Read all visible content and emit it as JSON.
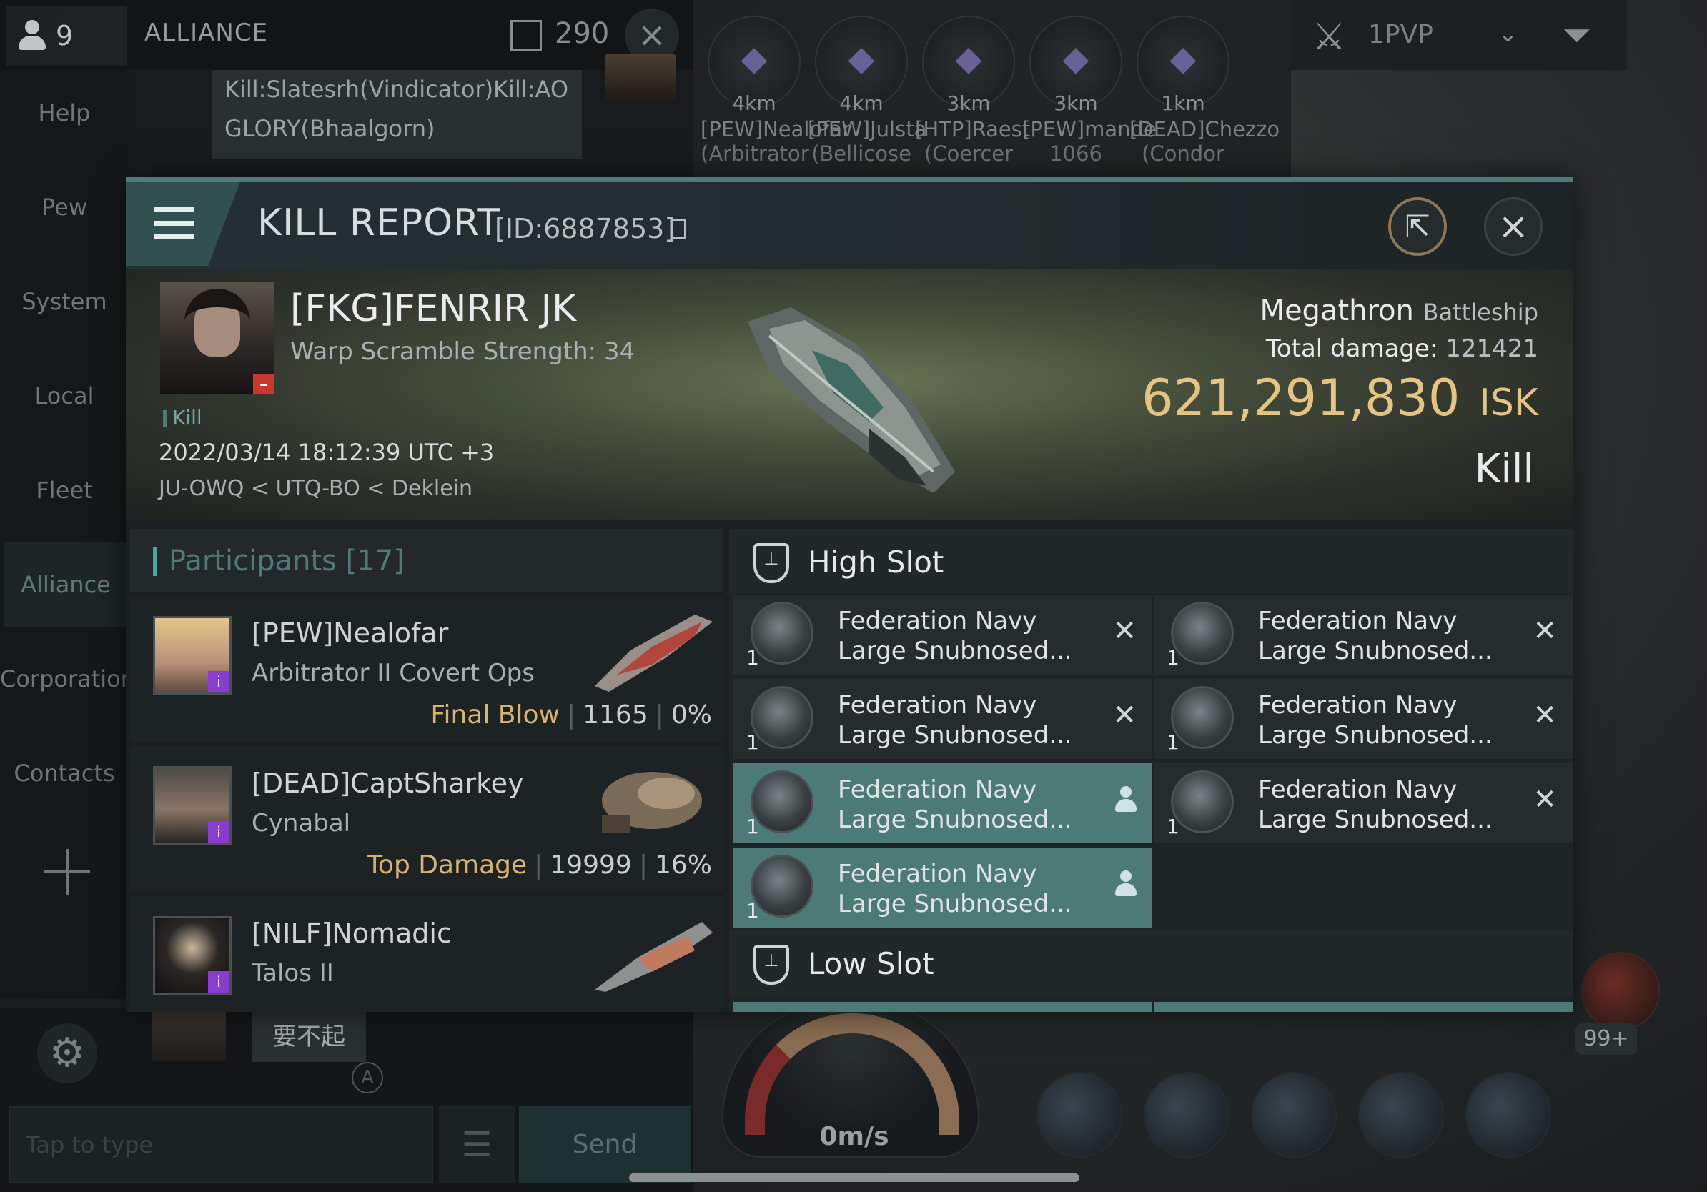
{
  "chat": {
    "member_count": "9",
    "channel_title": "ALLIANCE",
    "channel_count": "290",
    "close_icon": "close-icon",
    "top_message": "Kill:Slatesrh(Vindicator)Kill:AO GLORY(Bhaalgorn)",
    "bottom_message": "要不起",
    "bottom_marker": "A",
    "input_placeholder": "Tap to type",
    "send_label": "Send"
  },
  "nav": {
    "items": [
      "Help",
      "Pew",
      "System",
      "Local",
      "Fleet",
      "Alliance",
      "Corporation",
      "Contacts"
    ],
    "active": "Alliance"
  },
  "overview": {
    "targets": [
      {
        "distance": "4km",
        "name": "[PEW]Nealofar",
        "ship": "(Arbitrator"
      },
      {
        "distance": "4km",
        "name": "[PEW]Julsta",
        "ship": "(Bellicose"
      },
      {
        "distance": "3km",
        "name": "[HTP]Raest",
        "ship": "(Coercer"
      },
      {
        "distance": "3km",
        "name": "[PEW]mande",
        "ship": "1066"
      },
      {
        "distance": "1km",
        "name": "[DEAD]Chezzo",
        "ship": "(Condor"
      }
    ],
    "filter_label": "1PVP"
  },
  "hud": {
    "speed": "0m/s",
    "badge": "99+"
  },
  "kill_report": {
    "title": "KILL REPORT",
    "id": "[ID:6887853]",
    "victim": {
      "name": "[FKG]FENRIR JK",
      "subtitle": "Warp Scramble Strength: 34",
      "tag": "Kill",
      "time": "2022/03/14 18:12:39 UTC +3",
      "location": "JU-OWQ < UTQ-BO < Deklein"
    },
    "ship": {
      "name": "Megathron",
      "class": "Battleship",
      "damage_label": "Total damage:",
      "damage_value": "121421",
      "isk_value": "621,291,830",
      "isk_unit": "ISK",
      "result": "Kill"
    },
    "participants": {
      "header": "Participants [17]",
      "rows": [
        {
          "name": "[PEW]Nealofar",
          "ship": "Arbitrator II Covert Ops",
          "label": "Final Blow",
          "damage": "1165",
          "percent": "0%"
        },
        {
          "name": "[DEAD]CaptSharkey",
          "ship": "Cynabal",
          "label": "Top Damage",
          "damage": "19999",
          "percent": "16%"
        },
        {
          "name": "[NILF]Nomadic",
          "ship": "Talos II",
          "label": "",
          "damage": "",
          "percent": ""
        }
      ]
    },
    "fitting": {
      "high_slot_title": "High Slot",
      "low_slot_title": "Low Slot",
      "module_line1": "Federation Navy",
      "module_line2": "Large Snubnosed...",
      "quantity": "1"
    }
  }
}
